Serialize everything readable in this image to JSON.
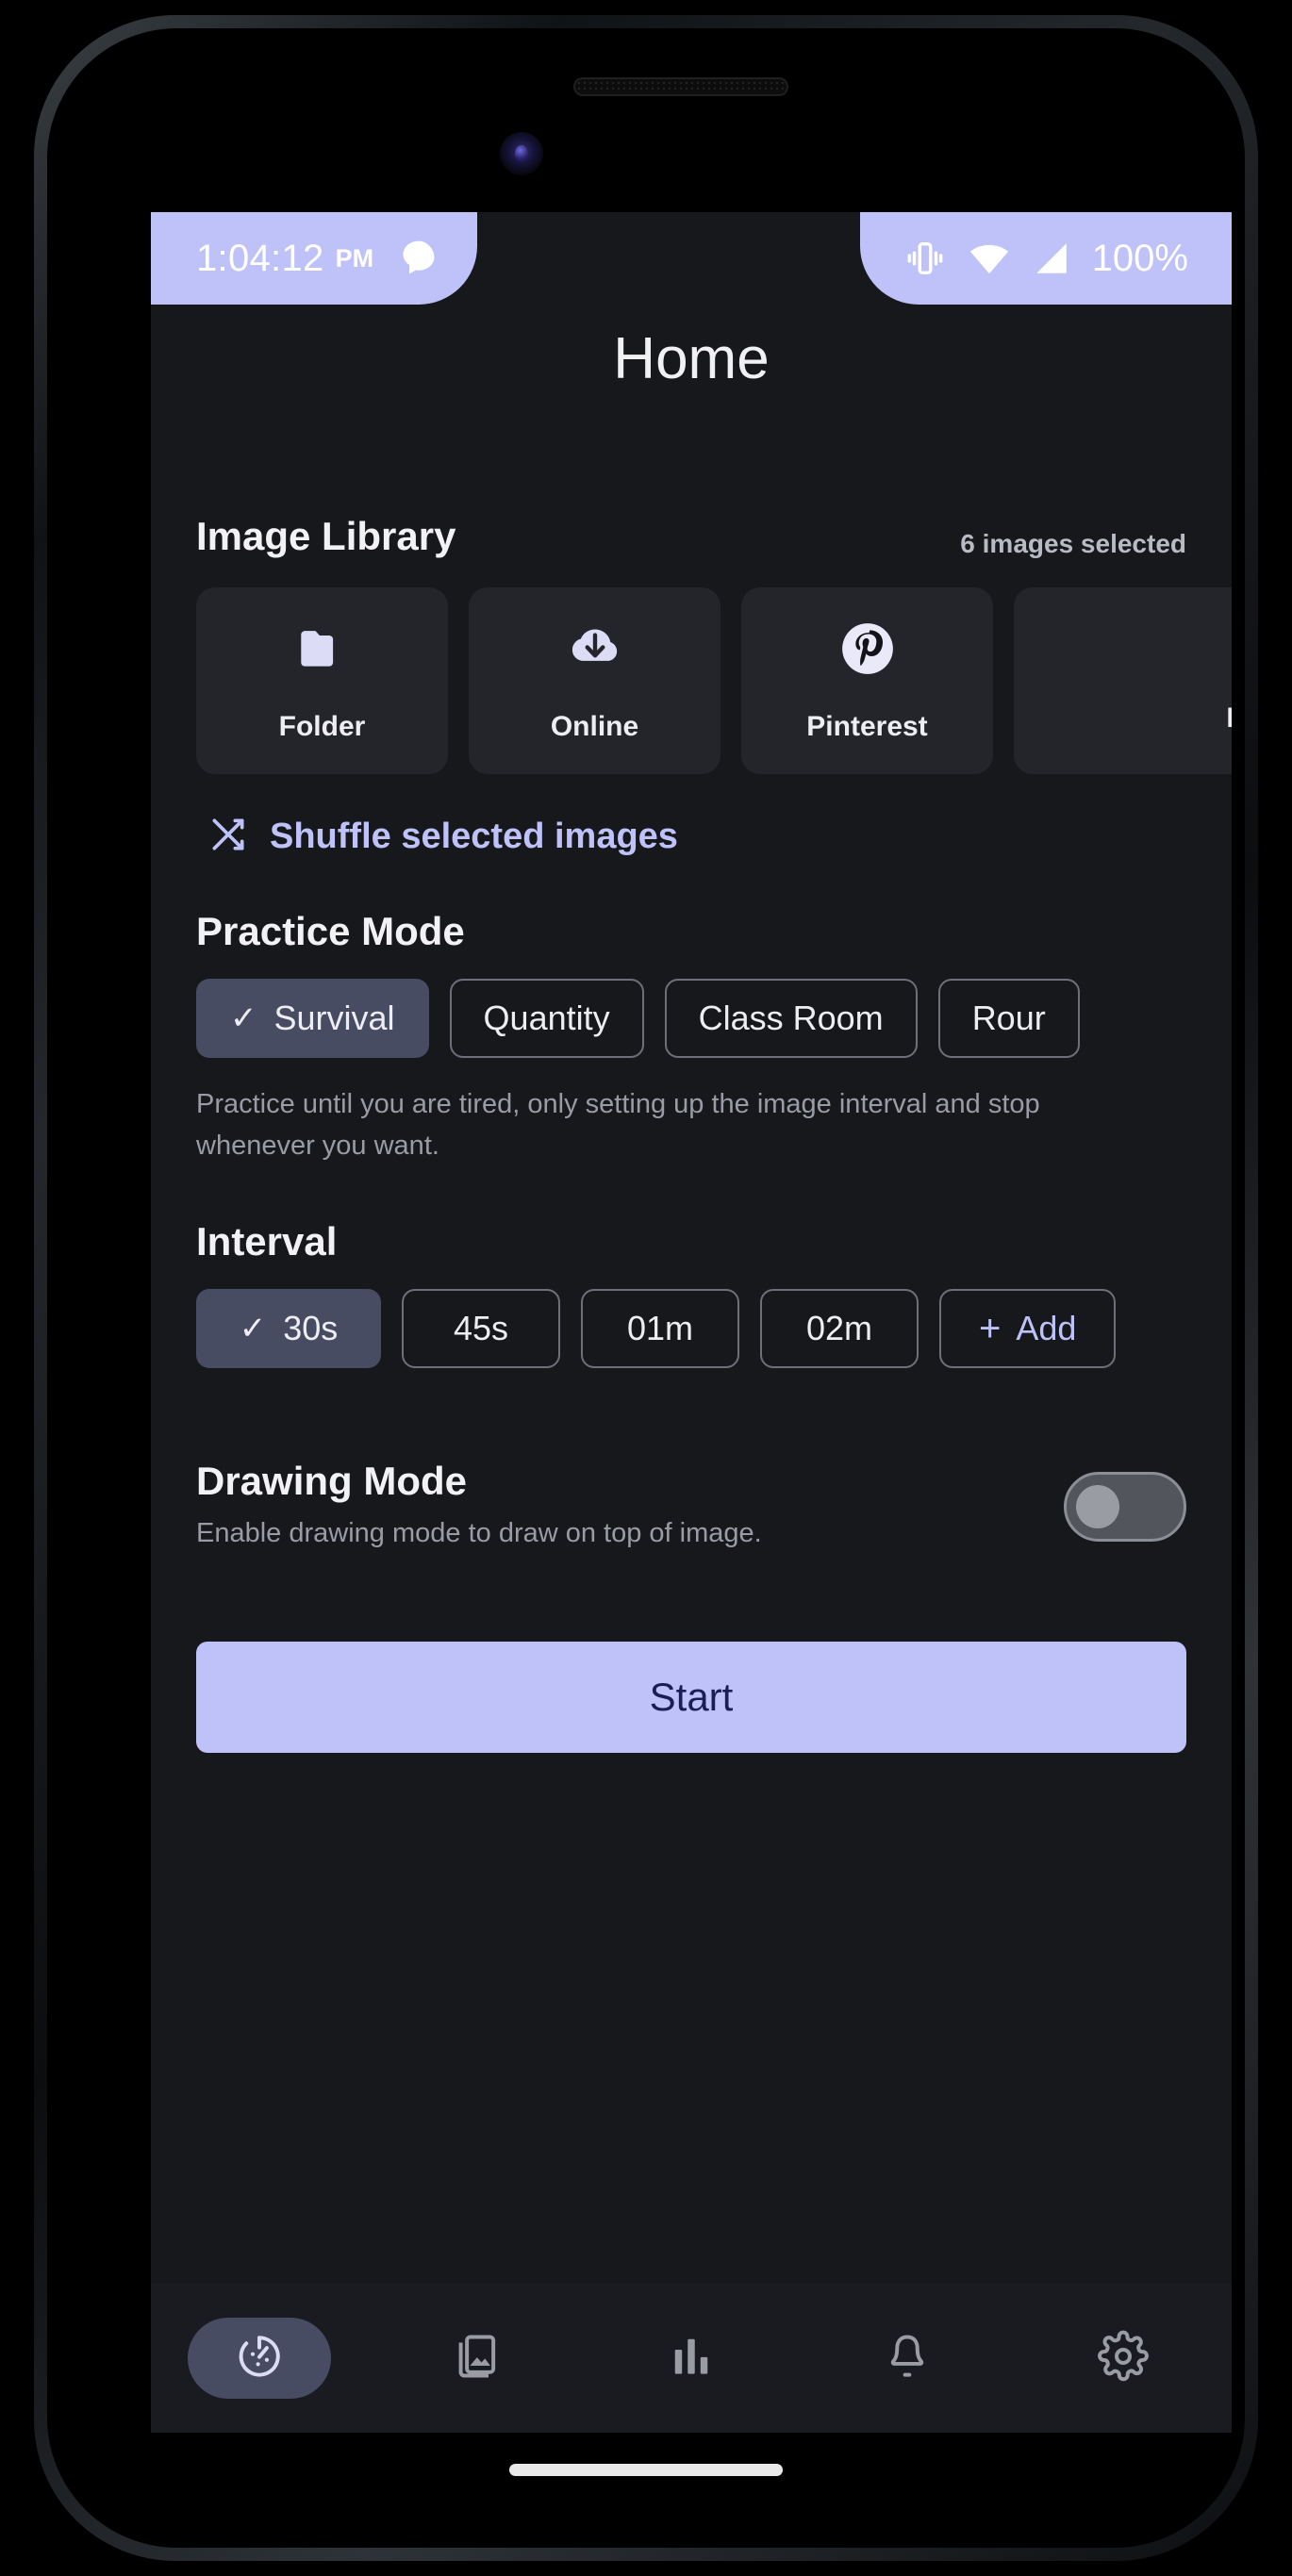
{
  "status_bar": {
    "time": "1:04:12",
    "ampm": "PM",
    "notification_icon": "chat-bubble-icon",
    "vibrate_icon": "vibrate-icon",
    "wifi_icon": "wifi-icon",
    "signal_icon": "cell-signal-icon",
    "battery_percent": "100%"
  },
  "header": {
    "title": "Home"
  },
  "image_library": {
    "title": "Image Library",
    "selected_count": "6 images selected",
    "sources": [
      {
        "label": "Folder",
        "icon": "folder-icon"
      },
      {
        "label": "Online",
        "icon": "cloud-download-icon"
      },
      {
        "label": "Pinterest",
        "icon": "pinterest-icon"
      },
      {
        "label": "My",
        "icon": "my-images-icon"
      }
    ],
    "shuffle": {
      "label": "Shuffle selected images",
      "icon": "shuffle-icon"
    }
  },
  "practice_mode": {
    "title": "Practice Mode",
    "options": [
      {
        "label": "Survival",
        "selected": true
      },
      {
        "label": "Quantity",
        "selected": false
      },
      {
        "label": "Class Room",
        "selected": false
      },
      {
        "label": "Rour",
        "selected": false
      }
    ],
    "description": "Practice until you are tired, only setting up the image interval and stop whenever you want."
  },
  "interval": {
    "title": "Interval",
    "options": [
      {
        "label": "30s",
        "selected": true
      },
      {
        "label": "45s",
        "selected": false
      },
      {
        "label": "01m",
        "selected": false
      },
      {
        "label": "02m",
        "selected": false
      }
    ],
    "add_label": "Add",
    "add_plus": "+"
  },
  "drawing_mode": {
    "title": "Drawing Mode",
    "description": "Enable drawing mode to draw on top of image.",
    "enabled": false
  },
  "start_button": {
    "label": "Start"
  },
  "bottom_nav": {
    "items": [
      {
        "name": "practice",
        "icon": "timer-gauge-icon",
        "active": true
      },
      {
        "name": "gallery",
        "icon": "images-icon",
        "active": false
      },
      {
        "name": "stats",
        "icon": "bar-chart-icon",
        "active": false
      },
      {
        "name": "alerts",
        "icon": "bell-icon",
        "active": false
      },
      {
        "name": "settings",
        "icon": "gear-icon",
        "active": false
      }
    ]
  },
  "colors": {
    "accent": "#bfc2f8",
    "screen_bg": "#17181c",
    "card_bg": "#24252b",
    "chip_selected_bg": "#474c63",
    "nav_bg": "#1a1b20",
    "start_text": "#1b1d57"
  }
}
